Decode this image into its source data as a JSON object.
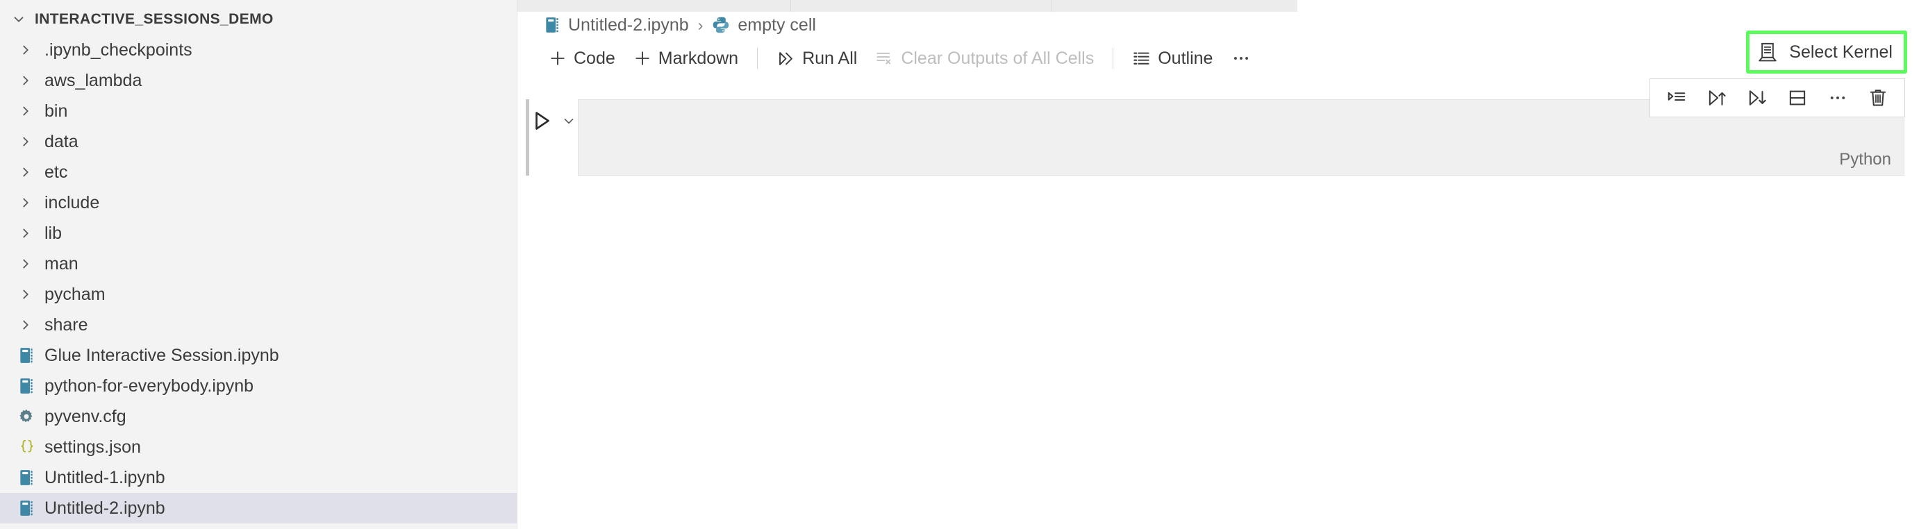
{
  "sidebar": {
    "header": {
      "title": "INTERACTIVE_SESSIONS_DEMO",
      "twisty_icon": "chevron-down-icon"
    },
    "items": [
      {
        "label": ".ipynb_checkpoints",
        "kind": "folder",
        "icon": "chevron-right-icon",
        "selected": false
      },
      {
        "label": "aws_lambda",
        "kind": "folder",
        "icon": "chevron-right-icon",
        "selected": false
      },
      {
        "label": "bin",
        "kind": "folder",
        "icon": "chevron-right-icon",
        "selected": false
      },
      {
        "label": "data",
        "kind": "folder",
        "icon": "chevron-right-icon",
        "selected": false
      },
      {
        "label": "etc",
        "kind": "folder",
        "icon": "chevron-right-icon",
        "selected": false
      },
      {
        "label": "include",
        "kind": "folder",
        "icon": "chevron-right-icon",
        "selected": false
      },
      {
        "label": "lib",
        "kind": "folder",
        "icon": "chevron-right-icon",
        "selected": false
      },
      {
        "label": "man",
        "kind": "folder",
        "icon": "chevron-right-icon",
        "selected": false
      },
      {
        "label": "pycham",
        "kind": "folder",
        "icon": "chevron-right-icon",
        "selected": false
      },
      {
        "label": "share",
        "kind": "folder",
        "icon": "chevron-right-icon",
        "selected": false
      },
      {
        "label": "Glue Interactive Session.ipynb",
        "kind": "notebook",
        "icon": "notebook-icon",
        "selected": false
      },
      {
        "label": "python-for-everybody.ipynb",
        "kind": "notebook",
        "icon": "notebook-icon",
        "selected": false
      },
      {
        "label": "pyvenv.cfg",
        "kind": "config",
        "icon": "gear-icon",
        "selected": false
      },
      {
        "label": "settings.json",
        "kind": "json",
        "icon": "json-braces-icon",
        "selected": false
      },
      {
        "label": "Untitled-1.ipynb",
        "kind": "notebook",
        "icon": "notebook-icon",
        "selected": false
      },
      {
        "label": "Untitled-2.ipynb",
        "kind": "notebook",
        "icon": "notebook-icon",
        "selected": true
      }
    ]
  },
  "editor": {
    "breadcrumb": {
      "file_icon": "notebook-icon",
      "file": "Untitled-2.ipynb",
      "separator": "›",
      "cell_icon": "python-icon",
      "cell": "empty cell"
    },
    "toolbar": {
      "add_code": "Code",
      "add_code_icon": "plus-icon",
      "add_markdown": "Markdown",
      "add_markdown_icon": "plus-icon",
      "run_all": "Run All",
      "run_all_icon": "run-all-icon",
      "clear_outputs": "Clear Outputs of All Cells",
      "clear_outputs_icon": "clear-outputs-icon",
      "clear_outputs_disabled": true,
      "outline": "Outline",
      "outline_icon": "outline-icon",
      "more": "⋯",
      "more_icon": "more-actions-icon"
    },
    "kernel": {
      "label": "Select Kernel",
      "icon": "kernel-server-icon",
      "highlight_color": "#5dfa5d",
      "highlighted": true
    },
    "cell_toolbar": {
      "buttons": [
        {
          "name": "run-by-line-icon",
          "title": "Run by Line"
        },
        {
          "name": "run-above-icon",
          "title": "Execute Above Cells"
        },
        {
          "name": "run-below-icon",
          "title": "Execute Cell and Below"
        },
        {
          "name": "split-cell-icon",
          "title": "Split Cell"
        },
        {
          "name": "more-actions-icon",
          "title": "More Actions"
        },
        {
          "name": "delete-cell-icon",
          "title": "Delete Cell"
        }
      ]
    },
    "cell": {
      "run_icon": "run-cell-icon",
      "chevron_icon": "chevron-down-icon",
      "content": "",
      "language": "Python"
    }
  },
  "colors": {
    "sidebar_bg": "#f3f3f3",
    "selected_row": "#e0e0eb",
    "notebook_icon": "#3f87a6",
    "json_icon": "#b3b329",
    "text": "#3b3b3b",
    "muted_text": "#616161",
    "disabled_text": "#bdbdbd",
    "cell_bg": "#f0f0f0",
    "kernel_highlight": "#5dfa5d"
  }
}
